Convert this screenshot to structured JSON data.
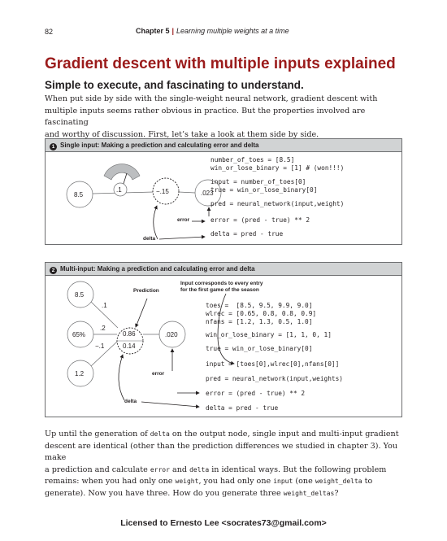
{
  "header": {
    "page_number": "82",
    "chapter": "Chapter 5",
    "chapter_title": "Learning multiple weights at a time"
  },
  "title": "Gradient descent with multiple inputs explained",
  "subtitle": "Simple to execute, and fascinating to understand.",
  "intro": {
    "line1": "When put side by side with the single-weight neural network, gradient descent with",
    "line2": "multiple inputs seems rather obvious in practice. But the properties involved are fascinating",
    "line3": "and worthy of discussion. First, let’s take a look at them side by side."
  },
  "figure1": {
    "number": "1",
    "heading": "Single input: Making a prediction and calculating error and delta",
    "input_value": "8.5",
    "weight_value": ".1",
    "prediction_value": "−.15",
    "error_value": ".023",
    "error_label": "error",
    "delta_label": "delta",
    "code": [
      "number_of_toes = [8.5]",
      "win_or_lose_binary = [1] # (won!!!)",
      "input = number_of_toes[0]",
      "true = win_or_lose_binary[0]",
      "pred = neural_network(input,weight)",
      "error = (pred - true) ** 2",
      "delta = pred - true"
    ]
  },
  "figure2": {
    "number": "2",
    "heading": "Multi-input: Making a prediction and calculating error and delta",
    "inputs": [
      "8.5",
      "65%",
      "1.2"
    ],
    "weights": [
      ".1",
      ".2",
      "−.1"
    ],
    "prediction_value": "0.86",
    "delta_value": "0.14",
    "error_value": ".020",
    "prediction_label": "Prediction",
    "error_label": "error",
    "delta_label": "delta",
    "note_line1": "Input corresponds to every entry",
    "note_line2": "for the first game of the season",
    "code": [
      "toes =  [8.5, 9.5, 9.9, 9.0]",
      "wlrec = [0.65, 0.8, 0.8, 0.9]",
      "nfans = [1.2, 1.3, 0.5, 1.0]",
      "win_or_lose_binary = [1, 1, 0, 1]",
      "true = win_or_lose_binary[0]",
      "input = [toes[0],wlrec[0],nfans[0]]",
      "pred = neural_network(input,weights)",
      "error = (pred - true) ** 2",
      "delta = pred - true"
    ]
  },
  "outro": {
    "l1a": "Up until the generation of ",
    "l1code": "delta",
    "l1b": " on the output node, single input and multi-input gradient",
    "l2": "descent are identical (other than the prediction differences we studied in chapter 3). You make",
    "l3a": "a prediction and calculate ",
    "l3code1": "error",
    "l3b": " and ",
    "l3code2": "delta",
    "l3c": " in identical ways. But the following problem",
    "l4a": "remains: when you had only one ",
    "l4code1": "weight",
    "l4b": ", you had only one ",
    "l4code2": "input",
    "l4c": " (one ",
    "l4code3": "weight_delta",
    "l4d": " to",
    "l5a": "generate). Now you have three. How do you generate three ",
    "l5code": "weight_deltas",
    "l5b": "?"
  },
  "footer": "Licensed to Ernesto Lee <socrates73@gmail.com>"
}
